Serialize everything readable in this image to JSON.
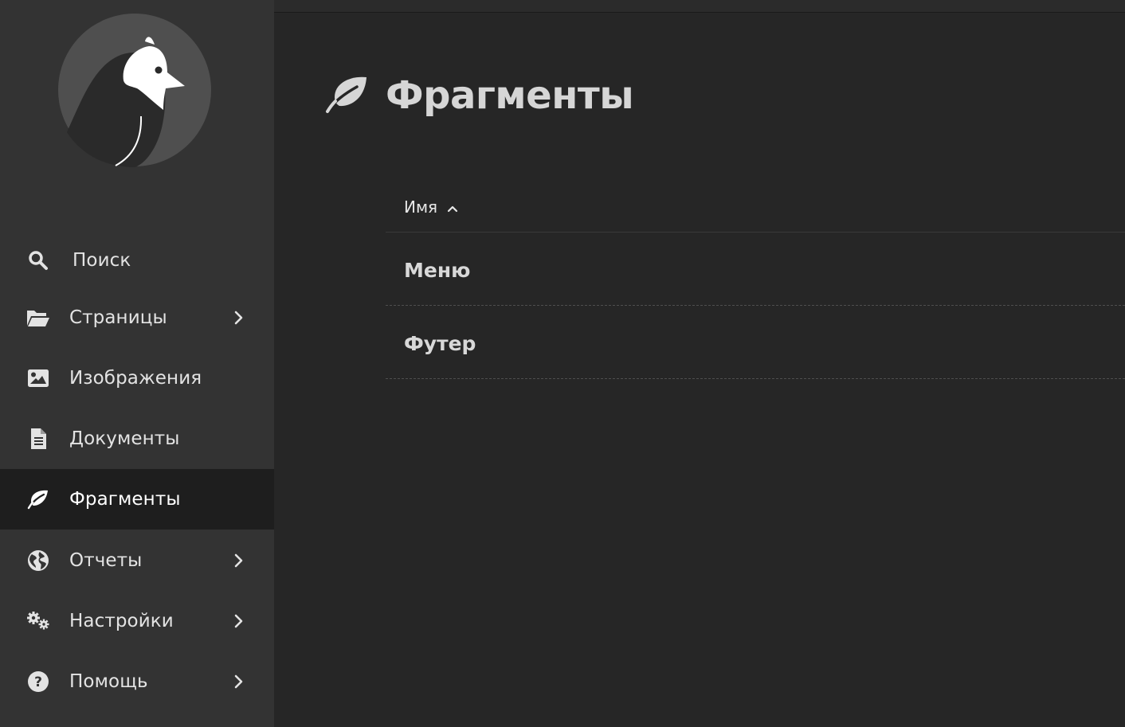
{
  "sidebar": {
    "logo_alt": "Wagtail",
    "items": [
      {
        "label": "Поиск",
        "icon": "search-icon",
        "has_submenu": false,
        "active": false
      },
      {
        "label": "Страницы",
        "icon": "folder-open-icon",
        "has_submenu": true,
        "active": false
      },
      {
        "label": "Изображения",
        "icon": "image-icon",
        "has_submenu": false,
        "active": false
      },
      {
        "label": "Документы",
        "icon": "document-icon",
        "has_submenu": false,
        "active": false
      },
      {
        "label": "Фрагменты",
        "icon": "leaf-icon",
        "has_submenu": false,
        "active": true
      },
      {
        "label": "Отчеты",
        "icon": "globe-icon",
        "has_submenu": true,
        "active": false
      },
      {
        "label": "Настройки",
        "icon": "cogs-icon",
        "has_submenu": true,
        "active": false
      },
      {
        "label": "Помощь",
        "icon": "help-icon",
        "has_submenu": true,
        "active": false
      }
    ]
  },
  "main": {
    "title": "Фрагменты",
    "title_icon": "leaf-icon",
    "table": {
      "column_header": "Имя",
      "sort_direction": "ascending",
      "rows": [
        "Меню",
        "Футер"
      ]
    }
  },
  "colors": {
    "sidebar_bg": "#333333",
    "active_item_bg": "#1e1e1e",
    "main_bg": "#262626",
    "text": "#e3e3e3"
  }
}
